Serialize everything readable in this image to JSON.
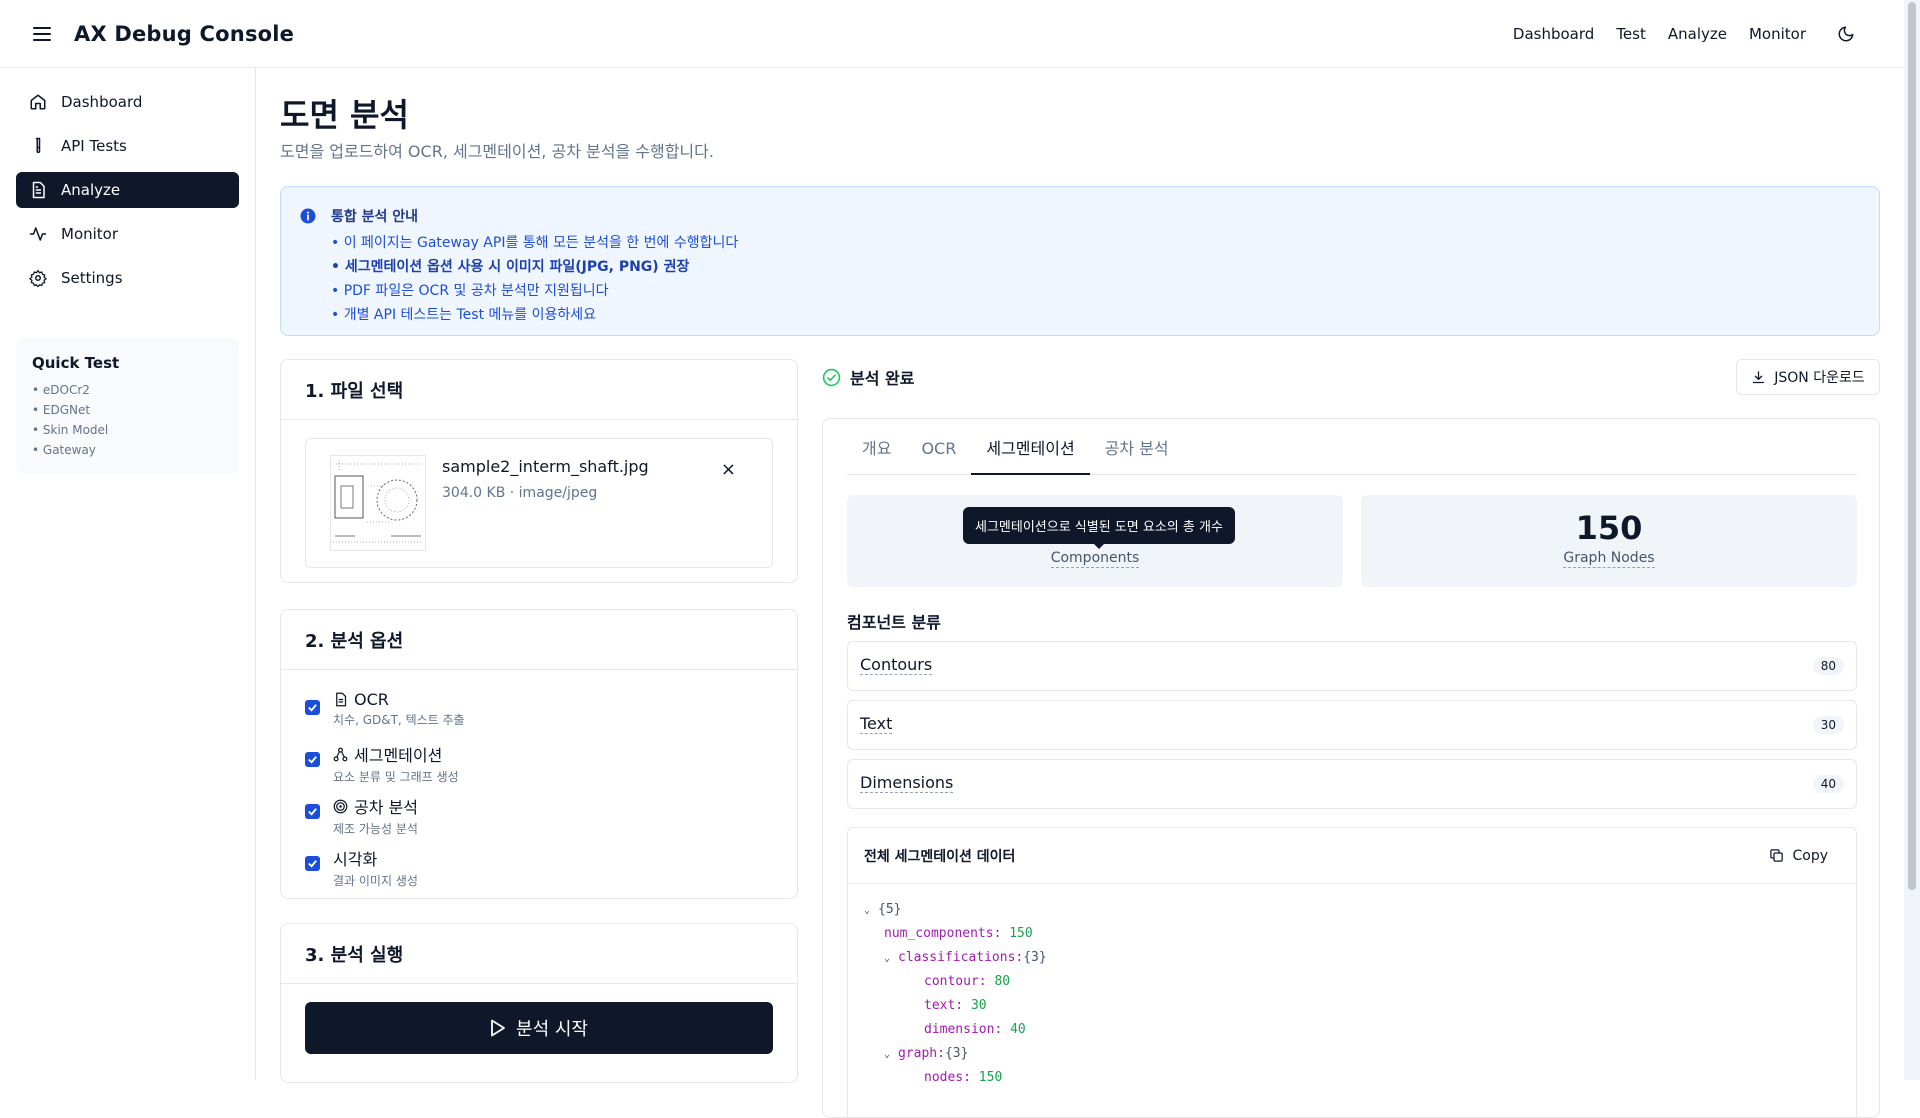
{
  "app": {
    "title": "AX Debug Console"
  },
  "topnav": [
    "Dashboard",
    "Test",
    "Analyze",
    "Monitor"
  ],
  "sidebar": {
    "items": [
      {
        "label": "Dashboard",
        "icon": "home-icon"
      },
      {
        "label": "API Tests",
        "icon": "test-tube-icon"
      },
      {
        "label": "Analyze",
        "icon": "file-text-icon",
        "active": true
      },
      {
        "label": "Monitor",
        "icon": "activity-icon"
      },
      {
        "label": "Settings",
        "icon": "gear-icon"
      }
    ],
    "quick_test": {
      "title": "Quick Test",
      "items": [
        "• eDOCr2",
        "• EDGNet",
        "• Skin Model",
        "• Gateway"
      ]
    }
  },
  "page": {
    "title": "도면 분석",
    "subtitle": "도면을 업로드하여 OCR, 세그멘테이션, 공차 분석을 수행합니다."
  },
  "info": {
    "title": "통합 분석 안내",
    "lines": [
      "• 이 페이지는 Gateway API를 통해 모든 분석을 한 번에 수행합니다",
      "• 세그멘테이션 옵션 사용 시 이미지 파일(JPG, PNG) 권장",
      "• PDF 파일은 OCR 및 공차 분석만 지원됩니다",
      "• 개별 API 테스트는 Test 메뉴를 이용하세요"
    ]
  },
  "file_card": {
    "title": "1. 파일 선택",
    "file_name": "sample2_interm_shaft.jpg",
    "file_meta": "304.0 KB · image/jpeg",
    "remove": "×"
  },
  "options_card": {
    "title": "2. 분석 옵션",
    "options": [
      {
        "label": "OCR",
        "desc": "치수, GD&T, 텍스트 추출",
        "checked": true,
        "icon": "file-icon"
      },
      {
        "label": "세그멘테이션",
        "desc": "요소 분류 및 그래프 생성",
        "checked": true,
        "icon": "network-icon"
      },
      {
        "label": "공차 분석",
        "desc": "제조 가능성 분석",
        "checked": true,
        "icon": "target-icon"
      },
      {
        "label": "시각화",
        "desc": "결과 이미지 생성",
        "checked": true,
        "icon": ""
      }
    ]
  },
  "run_card": {
    "title": "3. 분석 실행",
    "button": "분석 시작"
  },
  "result": {
    "status": "분석 완료",
    "download": "JSON 다운로드",
    "tabs": [
      "개요",
      "OCR",
      "세그멘테이션",
      "공차 분석"
    ],
    "active_tab": 2,
    "stats": [
      {
        "value": "",
        "caption": "Components",
        "tooltip": "세그멘테이션으로 식별된 도면 요소의 총 개수"
      },
      {
        "value": "150",
        "caption": "Graph Nodes"
      }
    ],
    "section_title": "컴포넌트 분류",
    "classes": [
      {
        "name": "Contours",
        "count": "80"
      },
      {
        "name": "Text",
        "count": "30"
      },
      {
        "name": "Dimensions",
        "count": "40"
      }
    ],
    "json_panel": {
      "title": "전체 세그멘테이션 데이터",
      "copy": "Copy",
      "root": "{5}",
      "num_components_key": "num_components:",
      "num_components_val": "150",
      "classifications_key": "classifications:",
      "classifications_count": "{3}",
      "contour_key": "contour:",
      "contour_val": "80",
      "text_key": "text:",
      "text_val": "30",
      "dimension_key": "dimension:",
      "dimension_val": "40",
      "graph_key": "graph:",
      "graph_count": "{3}",
      "nodes_key": "nodes:",
      "nodes_val": "150"
    }
  },
  "colors": {
    "primary": "#0f172a",
    "info_bg": "#eff6ff",
    "success": "#22c55e",
    "json_key": "#a21caf",
    "json_value": "#16a34a"
  }
}
